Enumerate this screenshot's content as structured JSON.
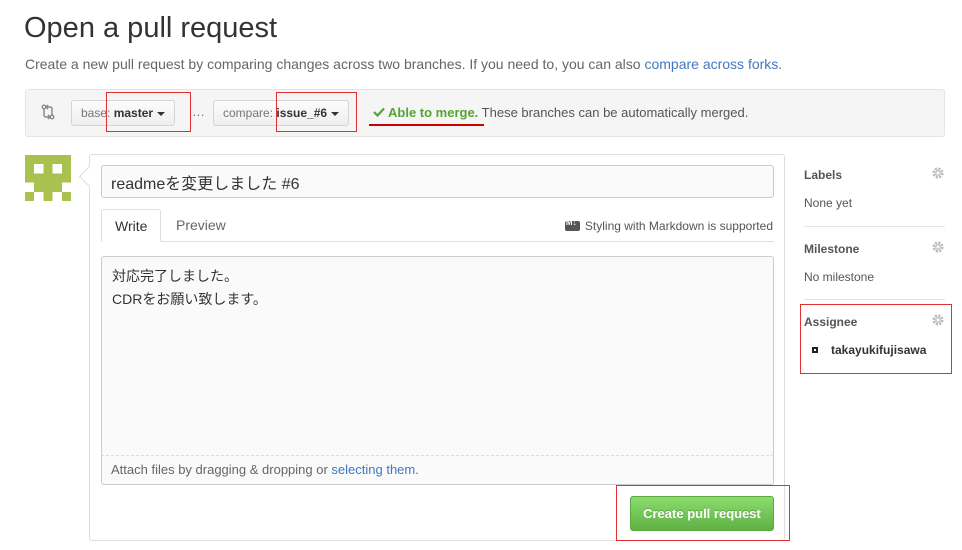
{
  "header": {
    "title": "Open a pull request",
    "subtitle_text": "Create a new pull request by comparing changes across two branches. If you need to, you can also ",
    "subtitle_link": "compare across forks",
    "subtitle_end": "."
  },
  "range": {
    "base_prefix": "base: ",
    "base_branch": "master",
    "separator": "…",
    "compare_prefix": "compare: ",
    "compare_branch": "issue_#6",
    "merge_ok": "Able to merge.",
    "merge_text": " These branches can be automatically merged."
  },
  "form": {
    "title_value": "readmeを変更しました #6",
    "tab_write": "Write",
    "tab_preview": "Preview",
    "markdown_hint": "Styling with Markdown is supported",
    "body_text": "対応完了しました。\nCDRをお願い致します。",
    "attach_text": "Attach files by dragging & dropping or ",
    "attach_link": "selecting them",
    "attach_end": ".",
    "submit_label": "Create pull request"
  },
  "sidebar": {
    "labels": {
      "heading": "Labels",
      "value": "None yet"
    },
    "milestone": {
      "heading": "Milestone",
      "value": "No milestone"
    },
    "assignee": {
      "heading": "Assignee",
      "value": "takayukifujisawa"
    }
  },
  "colors": {
    "link": "#4078c0",
    "merge_ok": "#55a532",
    "button_green": "#60b044",
    "annotation_red": "#e03030",
    "avatar_green": "#a9c24f"
  },
  "icons": {
    "compare": "git-compare-icon",
    "check": "check-icon",
    "markdown": "markdown-icon",
    "gear": "gear-icon"
  }
}
